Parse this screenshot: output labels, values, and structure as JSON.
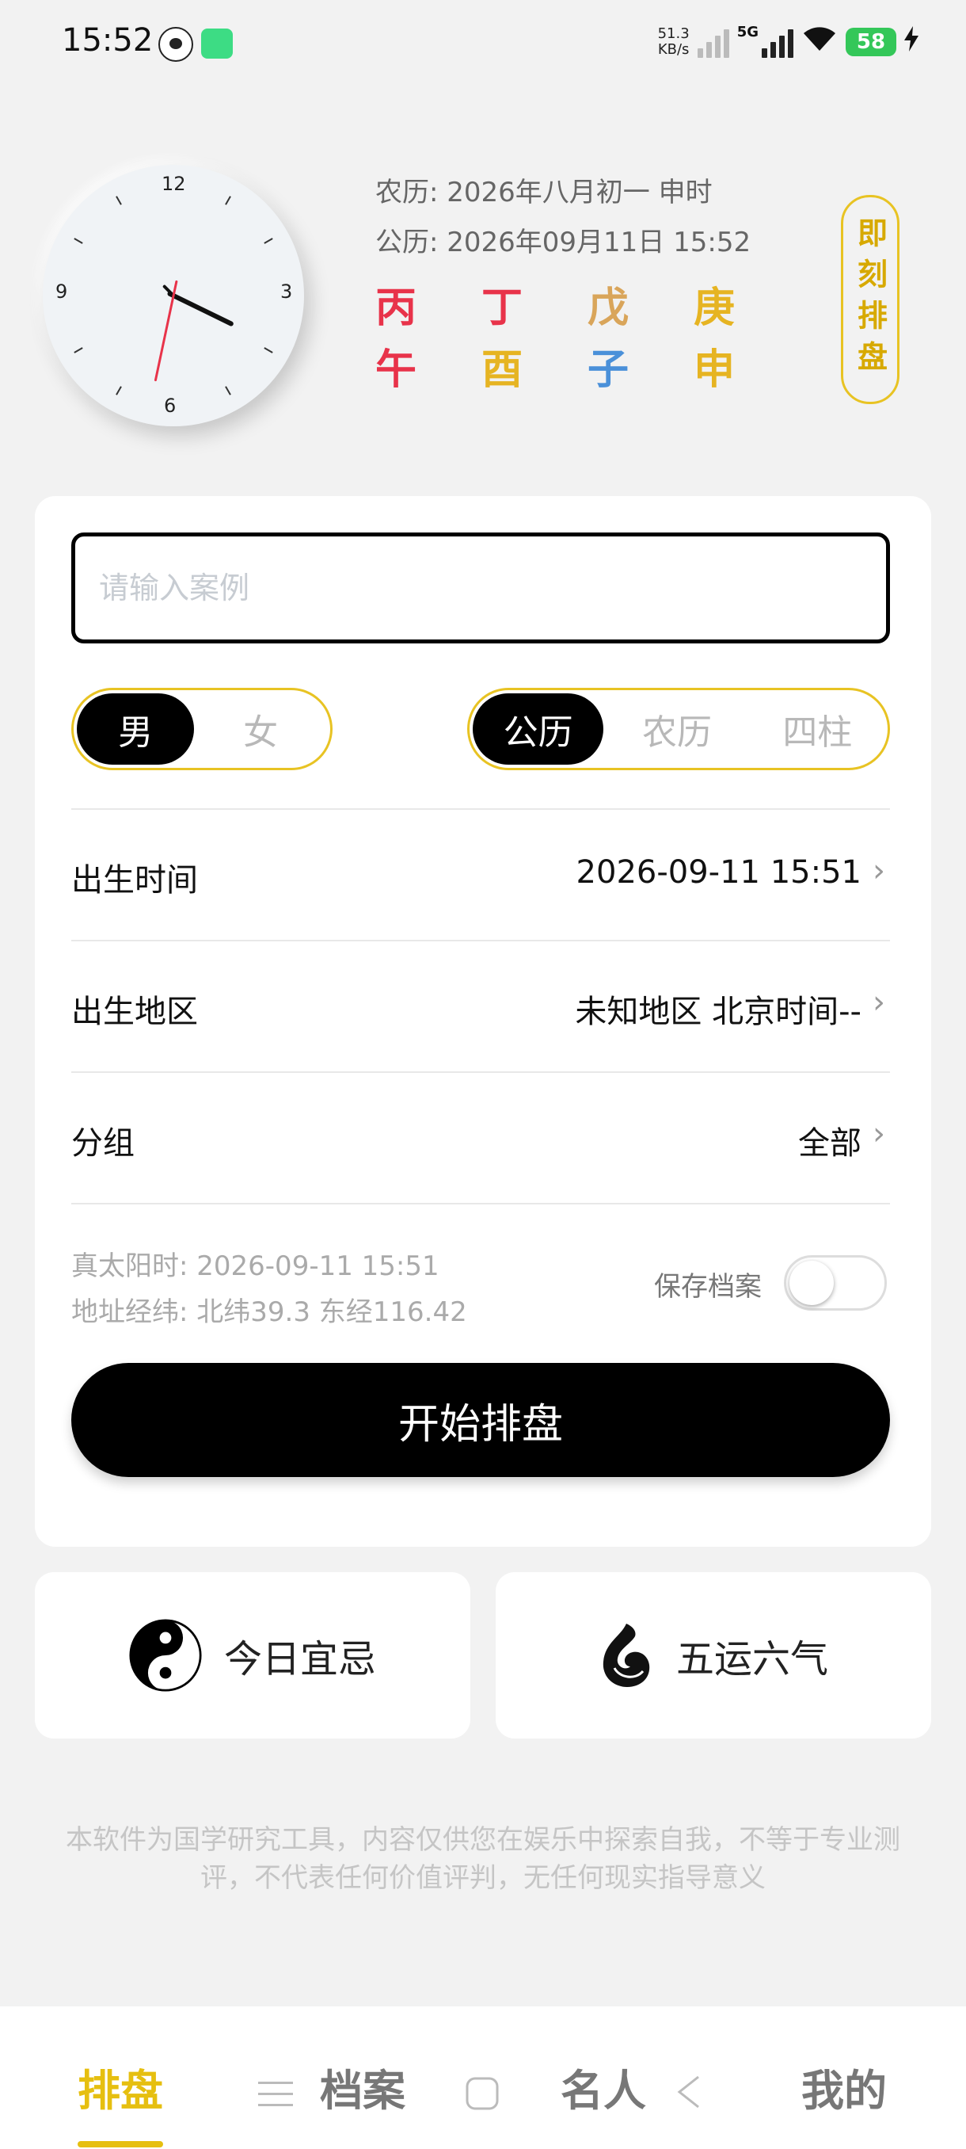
{
  "status_bar": {
    "time": "15:52",
    "net_speed_value": "51.3",
    "net_speed_unit": "KB/s",
    "network": "5G",
    "battery": "58"
  },
  "clock": {
    "numbers": {
      "top": "12",
      "right": "3",
      "bottom": "6",
      "left": "9"
    },
    "time": {
      "hour": 15,
      "minute": 52,
      "second": 32
    }
  },
  "date_info": {
    "lunar": "农历: 2026年八月初一  申时",
    "solar": "公历: 2026年09月11日 15:52",
    "ganzhi": {
      "stems": [
        {
          "char": "丙",
          "color": "#e8334a"
        },
        {
          "char": "丁",
          "color": "#e8334a"
        },
        {
          "char": "戊",
          "color": "#d9a55a"
        },
        {
          "char": "庚",
          "color": "#e6b422"
        }
      ],
      "branches": [
        {
          "char": "午",
          "color": "#e8334a"
        },
        {
          "char": "酉",
          "color": "#e6b422"
        },
        {
          "char": "子",
          "color": "#4a90d9"
        },
        {
          "char": "申",
          "color": "#e6b422"
        }
      ]
    },
    "quick_button": "即刻排盘"
  },
  "form": {
    "case_placeholder": "请输入案例",
    "gender": {
      "male": "男",
      "female": "女",
      "selected": "male"
    },
    "calendar": {
      "solar": "公历",
      "lunar": "农历",
      "pillars": "四柱",
      "selected": "solar"
    },
    "birth_time": {
      "label": "出生时间",
      "value": "2026-09-11 15:51"
    },
    "birth_region": {
      "label": "出生地区",
      "value": "未知地区 北京时间--"
    },
    "group": {
      "label": "分组",
      "value": "全部"
    },
    "true_solar_time": "真太阳时: 2026-09-11 15:51",
    "coordinates": "地址经纬: 北纬39.3 东经116.42",
    "save_label": "保存档案",
    "save_enabled": false,
    "start_button": "开始排盘"
  },
  "tiles": {
    "daily": {
      "label": "今日宜忌",
      "icon": "yin-yang-icon"
    },
    "wuyun": {
      "label": "五运六气",
      "icon": "swirl-icon"
    }
  },
  "disclaimer": "本软件为国学研究工具，内容仅供您在娱乐中探索自我，不等于专业测评，不代表任何价值评判，无任何现实指导意义",
  "bottom_nav": {
    "items": [
      {
        "label": "排盘",
        "active": true
      },
      {
        "label": "档案",
        "active": false
      },
      {
        "label": "名人",
        "active": false
      },
      {
        "label": "我的",
        "active": false
      }
    ]
  },
  "colors": {
    "accent": "#e6bf10",
    "border_yellow": "#e8c323",
    "primary_button": "#000000"
  }
}
